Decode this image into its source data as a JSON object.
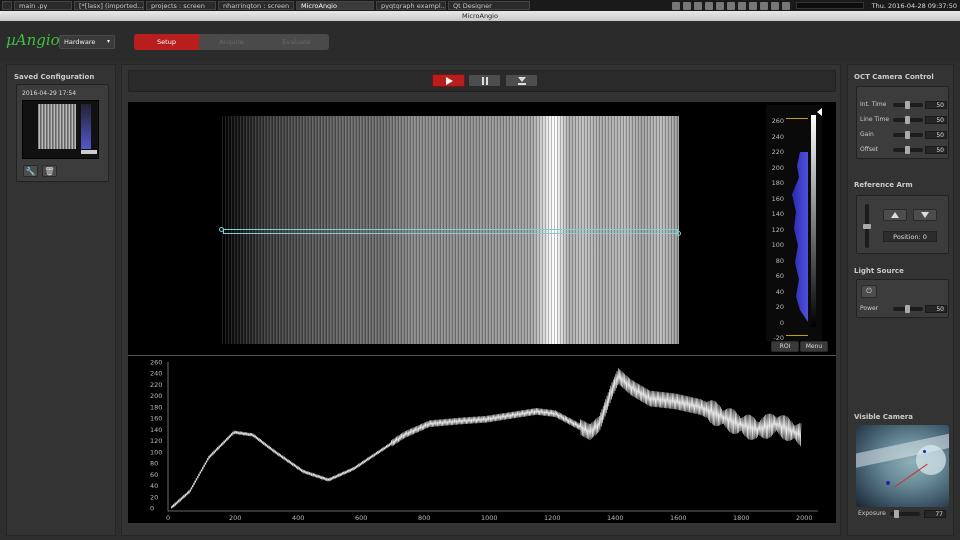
{
  "taskbar": {
    "tasks": [
      "main .py",
      "[*[lasx] (imported...",
      "projects : screen",
      "nharrington : screen",
      "MicroAngio",
      "pyqtgraph exampl...",
      "Qt Designer"
    ],
    "active_index": 4,
    "clock": "Thu. 2016-04-28 09:37:50"
  },
  "window": {
    "title": "MicroAngio"
  },
  "app": {
    "logo": "µAngio",
    "hardware": {
      "selected": "Hardware"
    },
    "modes": [
      "Setup",
      "Acquire",
      "Evaluate"
    ],
    "active_mode": "Setup"
  },
  "saved_config": {
    "title": "Saved Configuration",
    "item_timestamp": "2016-04-29 17:54"
  },
  "transport": {
    "play_icon": "play-icon",
    "pause_icon": "pause-icon",
    "save_icon": "download-icon"
  },
  "image_view": {
    "histogram_ticks": [
      "260",
      "240",
      "220",
      "200",
      "180",
      "160",
      "140",
      "120",
      "100",
      "80",
      "60",
      "40",
      "20",
      "0",
      "-20"
    ],
    "roi_label": "ROI",
    "menu_label": "Menu"
  },
  "profile_plot": {
    "y_ticks": [
      "260",
      "240",
      "220",
      "200",
      "180",
      "160",
      "140",
      "120",
      "100",
      "80",
      "60",
      "40",
      "20",
      "0"
    ],
    "x_ticks": [
      "0",
      "200",
      "400",
      "600",
      "800",
      "1000",
      "1200",
      "1400",
      "1600",
      "1800",
      "2000"
    ]
  },
  "oct_camera": {
    "title": "OCT Camera Control",
    "controls": [
      {
        "label": "Int. Time",
        "value": "50"
      },
      {
        "label": "Line Time",
        "value": "50"
      },
      {
        "label": "Gain",
        "value": "50"
      },
      {
        "label": "Offset",
        "value": "50"
      }
    ]
  },
  "reference_arm": {
    "title": "Reference Arm",
    "position": "Position: 0"
  },
  "light_source": {
    "title": "Light Source",
    "power_label": "Power",
    "power_value": "50"
  },
  "visible_camera": {
    "title": "Visible Camera",
    "exposure_label": "Exposure",
    "exposure_value": "77"
  },
  "colors": {
    "accent_red": "#b81e1e",
    "logo_green": "#3fbf3f",
    "histogram_blue": "#4040d0"
  }
}
